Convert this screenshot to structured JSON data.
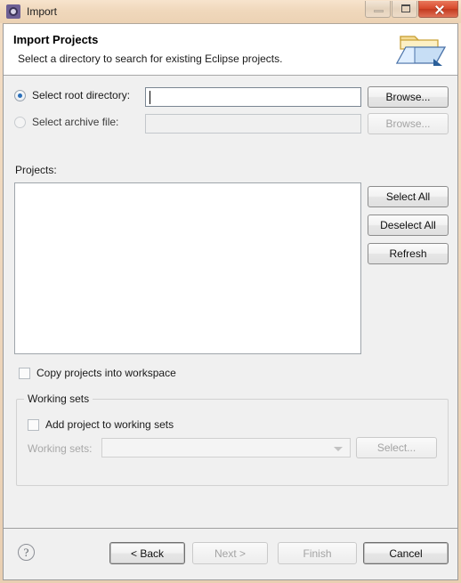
{
  "window": {
    "title": "Import",
    "app_icon": "import-wizard-icon",
    "controls": {
      "minimize": "minimize-button",
      "maximize": "maximize-button",
      "close": "close-button"
    }
  },
  "banner": {
    "title": "Import Projects",
    "subtitle": "Select a directory to search for existing Eclipse projects.",
    "icon": "import-folder-icon"
  },
  "source": {
    "root_directory": {
      "radio_label": "Select root directory:",
      "selected": true,
      "value": "",
      "browse_label": "Browse...",
      "browse_enabled": true
    },
    "archive_file": {
      "radio_label": "Select archive file:",
      "selected": false,
      "value": "",
      "browse_label": "Browse...",
      "browse_enabled": false
    }
  },
  "projects": {
    "label": "Projects:",
    "items": [],
    "buttons": {
      "select_all": "Select All",
      "deselect_all": "Deselect All",
      "refresh": "Refresh"
    }
  },
  "options": {
    "copy_projects": {
      "label": "Copy projects into workspace",
      "checked": false
    },
    "working_sets_group": {
      "title": "Working sets",
      "add_project": {
        "label": "Add project to working sets",
        "checked": false
      },
      "working_sets_field": {
        "label": "Working sets:",
        "value": "",
        "enabled": false
      },
      "select_button": {
        "label": "Select...",
        "enabled": false
      }
    }
  },
  "footer": {
    "help": "?",
    "buttons": [
      {
        "label": "< Back",
        "enabled": true,
        "default": true
      },
      {
        "label": "Next >",
        "enabled": false,
        "default": false
      },
      {
        "label": "Finish",
        "enabled": false,
        "default": false
      },
      {
        "label": "Cancel",
        "enabled": true,
        "default": true
      }
    ]
  },
  "colors": {
    "titlebar": "#f0d8bc",
    "dialog_bg": "#f0f0f0",
    "accent_radio": "#2a6fba",
    "close_button": "#d84a2c"
  }
}
